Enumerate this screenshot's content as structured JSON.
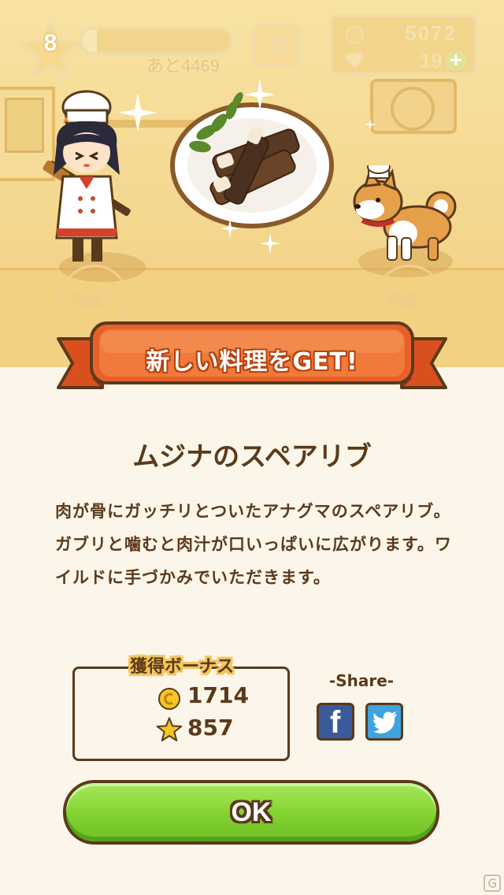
{
  "hud": {
    "level": "8",
    "xp_remaining": "あと4469",
    "xp_progress": 0.1,
    "coins": "5072",
    "gems": "19",
    "plus_icon": "plus-icon",
    "camera_icon": "camera-icon"
  },
  "scene": {
    "done_badge_left": "完成！",
    "done_badge_right": "完成！"
  },
  "banner": {
    "title": "新しい料理をGET!"
  },
  "dish": {
    "name": "ムジナのスペアリブ",
    "description": "肉が骨にガッチリとついたアナグマのスペアリブ。ガブリと噛むと肉汁が口いっぱいに広がります。ワイルドに手づかみでいただきます。"
  },
  "bonus": {
    "title": "獲得ボーナス",
    "coins": "1714",
    "stars": "857"
  },
  "share": {
    "label": "-Share-",
    "facebook_glyph": "f"
  },
  "ok_button": {
    "label": "OK"
  },
  "colors": {
    "text_brown": "#5b3a1c",
    "banner_orange": "#e8612a",
    "ok_green": "#86d433",
    "scene_yellow": "#f6dd95"
  }
}
